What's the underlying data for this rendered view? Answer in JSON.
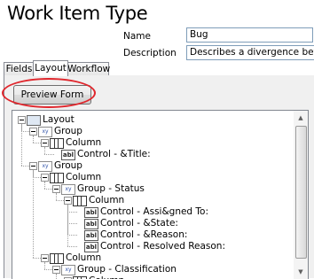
{
  "window": {
    "title": "Work Item Type"
  },
  "form": {
    "name_label": "Name",
    "name_value": "Bug",
    "description_label": "Description",
    "description_value": "Describes a divergence between re"
  },
  "tabs": [
    {
      "label": "Fields",
      "active": false
    },
    {
      "label": "Layout",
      "active": true
    },
    {
      "label": "Workflow",
      "active": false
    }
  ],
  "preview_button": {
    "label": "Preview Form"
  },
  "annotation": {
    "color": "#e0272d"
  },
  "icons": {
    "layout": "layout-icon",
    "group": "group-icon",
    "column": "column-icon",
    "control": "control-icon",
    "control_glyph": "abl",
    "group_glyph": "xy"
  },
  "tree": [
    {
      "label": "Layout",
      "type": "layout",
      "level": 0,
      "expandable": true
    },
    {
      "label": "Group",
      "type": "group",
      "level": 1,
      "expandable": true
    },
    {
      "label": "Column",
      "type": "column",
      "level": 2,
      "expandable": true
    },
    {
      "label": "Control - &Title:",
      "type": "control",
      "level": 3,
      "expandable": false
    },
    {
      "label": "Group",
      "type": "group",
      "level": 1,
      "expandable": true
    },
    {
      "label": "Column",
      "type": "column",
      "level": 2,
      "expandable": true
    },
    {
      "label": "Group - Status",
      "type": "group",
      "level": 3,
      "expandable": true
    },
    {
      "label": "Column",
      "type": "column",
      "level": 4,
      "expandable": true
    },
    {
      "label": "Control - Assi&gned To:",
      "type": "control",
      "level": 5,
      "expandable": false
    },
    {
      "label": "Control - &State:",
      "type": "control",
      "level": 5,
      "expandable": false
    },
    {
      "label": "Control - &Reason:",
      "type": "control",
      "level": 5,
      "expandable": false
    },
    {
      "label": "Control - Resolved Reason:",
      "type": "control",
      "level": 5,
      "expandable": false
    },
    {
      "label": "Column",
      "type": "column",
      "level": 2,
      "expandable": true
    },
    {
      "label": "Group - Classification",
      "type": "group",
      "level": 3,
      "expandable": true
    },
    {
      "label": "Column",
      "type": "column",
      "level": 4,
      "expandable": true
    }
  ]
}
